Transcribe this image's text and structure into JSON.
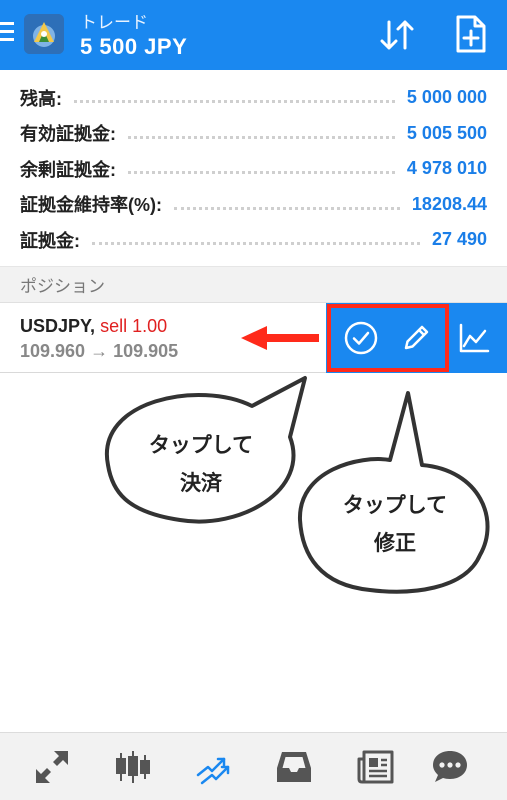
{
  "header": {
    "title": "トレード",
    "balance": "5 500 JPY",
    "icons": [
      "menu-icon",
      "app-logo",
      "sort-icon",
      "new-order-icon"
    ]
  },
  "account": {
    "rows": [
      {
        "label": "残高:",
        "value": "5 000 000"
      },
      {
        "label": "有効証拠金:",
        "value": "5 005 500"
      },
      {
        "label": "余剰証拠金:",
        "value": "4 978 010"
      },
      {
        "label": "証拠金維持率(%):",
        "value": "18208.44"
      },
      {
        "label": "証拠金:",
        "value": "27 490"
      }
    ]
  },
  "section": {
    "title": "ポジション"
  },
  "position": {
    "symbol": "USDJPY,",
    "side": "sell 1.00",
    "prices": "109.960 → 109.905"
  },
  "actions": [
    "close-position-button",
    "modify-position-button",
    "chart-button"
  ],
  "annotations": {
    "close": {
      "line1": "タップして",
      "line2": "決済"
    },
    "modify": {
      "line1": "タップして",
      "line2": "修正"
    }
  },
  "nav": {
    "items": [
      "quotes-icon",
      "chart-icon",
      "trade-icon",
      "history-icon",
      "news-icon",
      "chat-icon"
    ],
    "active": "trade-icon"
  },
  "colors": {
    "accent": "#1a88f0",
    "value": "#1a7ee8",
    "sell": "#e02020",
    "highlight": "#ff2a1a",
    "nav_icon": "#555555"
  }
}
